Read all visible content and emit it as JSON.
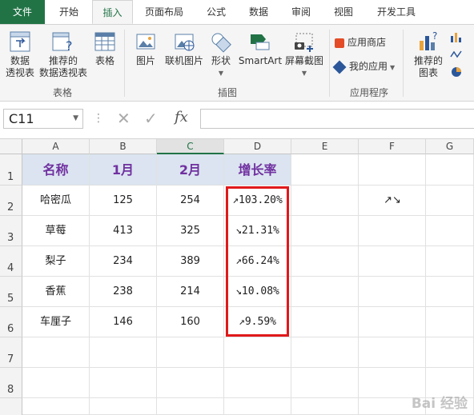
{
  "tabs": [
    "文件",
    "开始",
    "插入",
    "页面布局",
    "公式",
    "数据",
    "审阅",
    "视图",
    "开发工具"
  ],
  "ribbon": {
    "pivot_table": "数据\n透视表",
    "pivot_table_l1": "数据",
    "pivot_table_l2": "透视表",
    "rec_pivot_l1": "推荐的",
    "rec_pivot_l2": "数据透视表",
    "table": "表格",
    "group_tables": "表格",
    "picture": "图片",
    "online_picture": "联机图片",
    "shapes": "形状",
    "smartart": "SmartArt",
    "screenshot": "屏幕截图",
    "group_illustrations": "插图",
    "app_store": "应用商店",
    "my_apps": "我的应用",
    "group_apps": "应用程序",
    "rec_chart_l1": "推荐的",
    "rec_chart_l2": "图表"
  },
  "formula_bar": {
    "name_box": "C11",
    "fx": "fx",
    "formula": ""
  },
  "columns": [
    "A",
    "B",
    "C",
    "D",
    "E",
    "F",
    "G"
  ],
  "rows": [
    "1",
    "2",
    "3",
    "4",
    "5",
    "6",
    "7",
    "8"
  ],
  "table": {
    "headers": [
      "名称",
      "1月",
      "2月",
      "增长率"
    ],
    "data": [
      [
        "哈密瓜",
        "125",
        "254",
        "↗103.20%"
      ],
      [
        "草莓",
        "413",
        "325",
        "↘21.31%"
      ],
      [
        "梨子",
        "234",
        "389",
        "↗66.24%"
      ],
      [
        "香蕉",
        "238",
        "214",
        "↘10.08%"
      ],
      [
        "车厘子",
        "146",
        "160",
        "↗9.59%"
      ]
    ]
  },
  "f2": "↗↘",
  "watermark": "Bai 经验",
  "colors": {
    "accent": "#217346",
    "header_fill": "#dbe4f0",
    "header_text": "#7030a0",
    "highlight": "#e0191b"
  }
}
